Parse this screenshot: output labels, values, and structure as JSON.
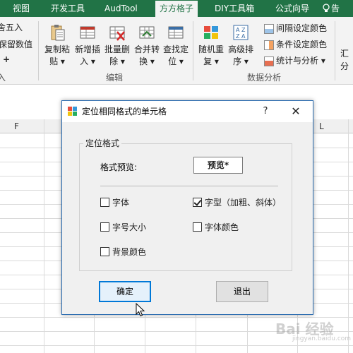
{
  "tabs": [
    "视图",
    "开发工具",
    "AudTool",
    "方方格子",
    "DIY工具箱",
    "公式向导"
  ],
  "active_tab": "方方格子",
  "tab_extra": "告",
  "ribbon": {
    "left_items": [
      "舍五入",
      "保留数值",
      "+",
      "入"
    ],
    "buttons": [
      {
        "line1": "复制粘",
        "line2": "贴 ▾",
        "icon": "clipboard-icon"
      },
      {
        "line1": "新增插",
        "line2": "入 ▾",
        "icon": "insert-rows-icon"
      },
      {
        "line1": "批量删",
        "line2": "除 ▾",
        "icon": "delete-cells-icon"
      },
      {
        "line1": "合并转",
        "line2": "换 ▾",
        "icon": "merge-convert-icon"
      },
      {
        "line1": "查找定",
        "line2": "位 ▾",
        "icon": "find-locate-icon"
      },
      {
        "line1": "随机重",
        "line2": "复 ▾",
        "icon": "random-repeat-icon"
      },
      {
        "line1": "高级排",
        "line2": "序 ▾",
        "icon": "sort-az-icon"
      }
    ],
    "group_edit": "编辑",
    "group_analysis": "数据分析",
    "small_buttons": [
      "间隔设定颜色",
      "条件设定颜色",
      "统计与分析 ▾"
    ],
    "right_items": [
      "汇",
      "分"
    ]
  },
  "sheet": {
    "columns": [
      "F",
      "L"
    ]
  },
  "dialog": {
    "title": "定位相同格式的单元格",
    "help": "?",
    "close": "✕",
    "group_title": "定位格式",
    "preview_label": "格式预览:",
    "preview_value": "预览*",
    "checkboxes": [
      {
        "label": "字体",
        "checked": false
      },
      {
        "label": "字型（加粗、斜体）",
        "checked": true
      },
      {
        "label": "字号大小",
        "checked": false
      },
      {
        "label": "字体颜色",
        "checked": false
      },
      {
        "label": "背景颜色",
        "checked": false
      }
    ],
    "ok_label": "确定",
    "exit_label": "退出"
  },
  "watermark": {
    "text": "Bai 经验",
    "sub": "jingyan.baidu.com"
  },
  "colors": {
    "excel_green": "#217346",
    "dialog_border": "#2b6cb0",
    "primary_button_border": "#0078d7"
  }
}
